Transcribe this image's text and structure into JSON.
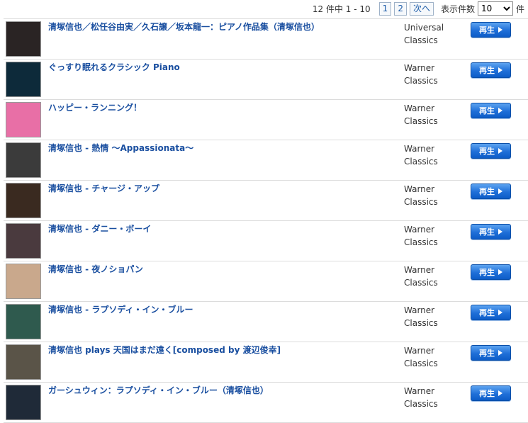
{
  "pager": {
    "count_text": "12 件中 1 - 10",
    "pages": [
      "1",
      "2"
    ],
    "next_label": "次へ",
    "per_page_label": "表示件数",
    "per_page_value": "10",
    "per_page_unit": "件"
  },
  "play_label": "再生",
  "items": [
    {
      "title": "清塚信也／松任谷由実／久石譲／坂本龍一：ピアノ作品集（清塚信也）",
      "label_line1": "Universal",
      "label_line2": "Classics",
      "thumb": "#2a2424"
    },
    {
      "title": "ぐっすり眠れるクラシック Piano",
      "label_line1": "Warner",
      "label_line2": "Classics",
      "thumb": "#0d2a3a"
    },
    {
      "title": "ハッピー・ランニング！",
      "label_line1": "Warner",
      "label_line2": "Classics",
      "thumb": "#e86fa6"
    },
    {
      "title": "清塚信也 - 熱情 ～Appassionata～",
      "label_line1": "Warner",
      "label_line2": "Classics",
      "thumb": "#3b3b3b"
    },
    {
      "title": "清塚信也 - チャージ・アップ",
      "label_line1": "Warner",
      "label_line2": "Classics",
      "thumb": "#3a2a20"
    },
    {
      "title": "清塚信也 - ダニー・ボーイ",
      "label_line1": "Warner",
      "label_line2": "Classics",
      "thumb": "#4a3a3e"
    },
    {
      "title": "清塚信也 - 夜ノショパン",
      "label_line1": "Warner",
      "label_line2": "Classics",
      "thumb": "#c9a88c"
    },
    {
      "title": "清塚信也 - ラプソディ・イン・ブルー",
      "label_line1": "Warner",
      "label_line2": "Classics",
      "thumb": "#2f5a4e"
    },
    {
      "title": "清塚信也 plays 天国はまだ遠く[composed by 渡辺俊幸]",
      "label_line1": "Warner",
      "label_line2": "Classics",
      "thumb": "#5a5448"
    },
    {
      "title": "ガーシュウィン：ラプソディ・イン・ブルー（清塚信也）",
      "label_line1": "Warner",
      "label_line2": "Classics",
      "thumb": "#1f2a38"
    }
  ]
}
